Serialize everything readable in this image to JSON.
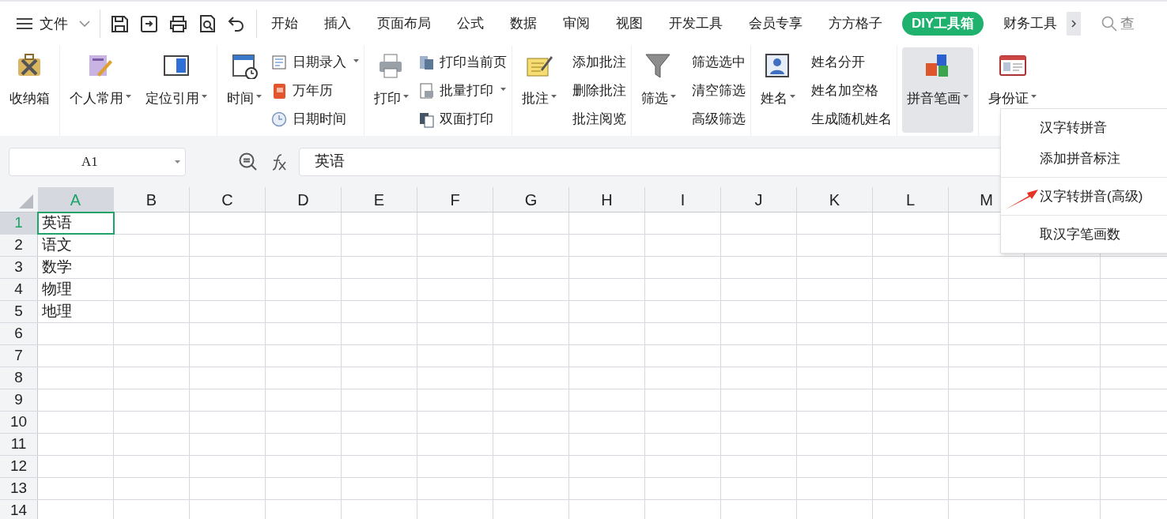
{
  "file_menu": {
    "label": "文件"
  },
  "tabs": [
    {
      "label": "开始",
      "selected": false
    },
    {
      "label": "插入",
      "selected": false
    },
    {
      "label": "页面布局",
      "selected": false
    },
    {
      "label": "公式",
      "selected": false
    },
    {
      "label": "数据",
      "selected": false
    },
    {
      "label": "审阅",
      "selected": false
    },
    {
      "label": "视图",
      "selected": false
    },
    {
      "label": "开发工具",
      "selected": false
    },
    {
      "label": "会员专享",
      "selected": false
    },
    {
      "label": "方方格子",
      "selected": false
    },
    {
      "label": "DIY工具箱",
      "selected": true
    },
    {
      "label": "财务工具",
      "selected": false
    }
  ],
  "search": {
    "placeholder": "查"
  },
  "ribbon": {
    "groups": [
      {
        "large": [
          {
            "label": "收纳箱",
            "dropdown": false,
            "expanded": false
          }
        ]
      },
      {
        "large": [
          {
            "label": "个人常用",
            "dropdown": true,
            "expanded": false
          },
          {
            "label": "定位引用",
            "dropdown": true,
            "expanded": false
          }
        ]
      },
      {
        "large": [
          {
            "label": "时间",
            "dropdown": true,
            "expanded": false
          }
        ],
        "small": [
          {
            "label": "日期录入",
            "dropdown": true,
            "kind": "icon_row"
          },
          {
            "label": "万年历",
            "dropdown": false,
            "kind": "icon_row"
          },
          {
            "label": "日期时间",
            "dropdown": false,
            "kind": "icon_row"
          }
        ]
      },
      {
        "large": [
          {
            "label": "打印",
            "dropdown": true,
            "expanded": false
          }
        ],
        "small": [
          {
            "label": "打印当前页",
            "dropdown": false,
            "kind": "icon_row"
          },
          {
            "label": "批量打印",
            "dropdown": true,
            "kind": "icon_row"
          },
          {
            "label": "双面打印",
            "dropdown": false,
            "kind": "icon_row"
          }
        ]
      },
      {
        "large": [
          {
            "label": "批注",
            "dropdown": true,
            "expanded": false
          }
        ],
        "small": [
          {
            "label": "添加批注",
            "dropdown": false,
            "kind": "text_row"
          },
          {
            "label": "删除批注",
            "dropdown": false,
            "kind": "text_row"
          },
          {
            "label": "批注阅览",
            "dropdown": false,
            "kind": "text_row"
          }
        ]
      },
      {
        "large": [
          {
            "label": "筛选",
            "dropdown": true,
            "expanded": false
          }
        ],
        "small": [
          {
            "label": "筛选选中",
            "dropdown": false,
            "kind": "text_row"
          },
          {
            "label": "清空筛选",
            "dropdown": false,
            "kind": "text_row"
          },
          {
            "label": "高级筛选",
            "dropdown": false,
            "kind": "text_row"
          }
        ]
      },
      {
        "large": [
          {
            "label": "姓名",
            "dropdown": true,
            "expanded": false
          }
        ],
        "small": [
          {
            "label": "姓名分开",
            "dropdown": false,
            "kind": "text_row"
          },
          {
            "label": "姓名加空格",
            "dropdown": false,
            "kind": "text_row"
          },
          {
            "label": "生成随机姓名",
            "dropdown": false,
            "kind": "text_row"
          }
        ]
      },
      {
        "large": [
          {
            "label": "拼音笔画",
            "dropdown": true,
            "expanded": true
          }
        ]
      },
      {
        "large": [
          {
            "label": "身份证",
            "dropdown": true,
            "expanded": false
          }
        ]
      }
    ]
  },
  "name_box": {
    "value": "A1"
  },
  "formula_bar": {
    "value": "英语"
  },
  "sheet": {
    "columns": [
      "A",
      "B",
      "C",
      "D",
      "E",
      "F",
      "G",
      "H",
      "I",
      "J",
      "K",
      "L",
      "M"
    ],
    "rows": [
      {
        "label": "1",
        "cells": [
          {
            "text": "英语",
            "selected": true
          }
        ]
      },
      {
        "label": "2",
        "cells": [
          {
            "text": "语文",
            "selected": false
          }
        ]
      },
      {
        "label": "3",
        "cells": [
          {
            "text": "数学",
            "selected": false
          }
        ]
      },
      {
        "label": "4",
        "cells": [
          {
            "text": "物理",
            "selected": false
          }
        ]
      },
      {
        "label": "5",
        "cells": [
          {
            "text": "地理",
            "selected": false
          }
        ]
      },
      {
        "label": "6"
      },
      {
        "label": "7"
      },
      {
        "label": "8"
      },
      {
        "label": "9"
      },
      {
        "label": "10"
      },
      {
        "label": "11"
      },
      {
        "label": "12"
      },
      {
        "label": "13"
      },
      {
        "label": "14"
      }
    ]
  },
  "dropdown_menu": {
    "sections": [
      [
        "汉字转拼音",
        "添加拼音标注"
      ],
      [
        "汉字转拼音(高级)"
      ],
      [
        "取汉字笔画数"
      ]
    ]
  }
}
